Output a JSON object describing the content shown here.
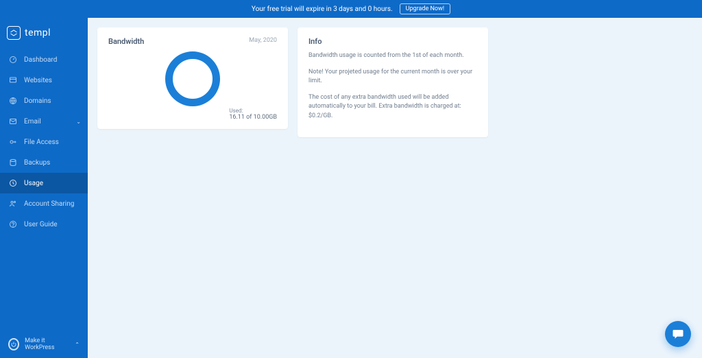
{
  "banner": {
    "text": "Your free trial will expire in 3 days and 0 hours.",
    "cta": "Upgrade Now!"
  },
  "brand": {
    "name": "templ"
  },
  "sidebar": {
    "items": [
      {
        "label": "Dashboard",
        "name": "dashboard",
        "active": false,
        "chev": false
      },
      {
        "label": "Websites",
        "name": "websites",
        "active": false,
        "chev": false
      },
      {
        "label": "Domains",
        "name": "domains",
        "active": false,
        "chev": false
      },
      {
        "label": "Email",
        "name": "email",
        "active": false,
        "chev": true
      },
      {
        "label": "File Access",
        "name": "file-access",
        "active": false,
        "chev": false
      },
      {
        "label": "Backups",
        "name": "backups",
        "active": false,
        "chev": false
      },
      {
        "label": "Usage",
        "name": "usage",
        "active": true,
        "chev": false
      },
      {
        "label": "Account Sharing",
        "name": "account-sharing",
        "active": false,
        "chev": false
      },
      {
        "label": "User Guide",
        "name": "user-guide",
        "active": false,
        "chev": false
      }
    ],
    "footer": {
      "label": "Make it WorkPress"
    }
  },
  "bandwidth": {
    "title": "Bandwidth",
    "date": "May, 2020",
    "used_label": "Used:",
    "used_value": "16.11 of 10.00GB"
  },
  "info": {
    "title": "Info",
    "p1": "Bandwidth usage is counted from the 1st of each month.",
    "p2": "Note! Your projeted usage for the current month is over your limit.",
    "p3": "The cost of any extra bandwidth used will be added automatically to your bill. Extra bandwidth is charged at: $0.2/GB."
  },
  "chart_data": {
    "type": "pie",
    "title": "Bandwidth",
    "series": [
      {
        "name": "Used",
        "value": 16.11,
        "unit": "GB",
        "color": "#1b7fd8"
      }
    ],
    "limit": 10.0,
    "note": "Usage exceeds limit; donut ring shown fully filled."
  }
}
